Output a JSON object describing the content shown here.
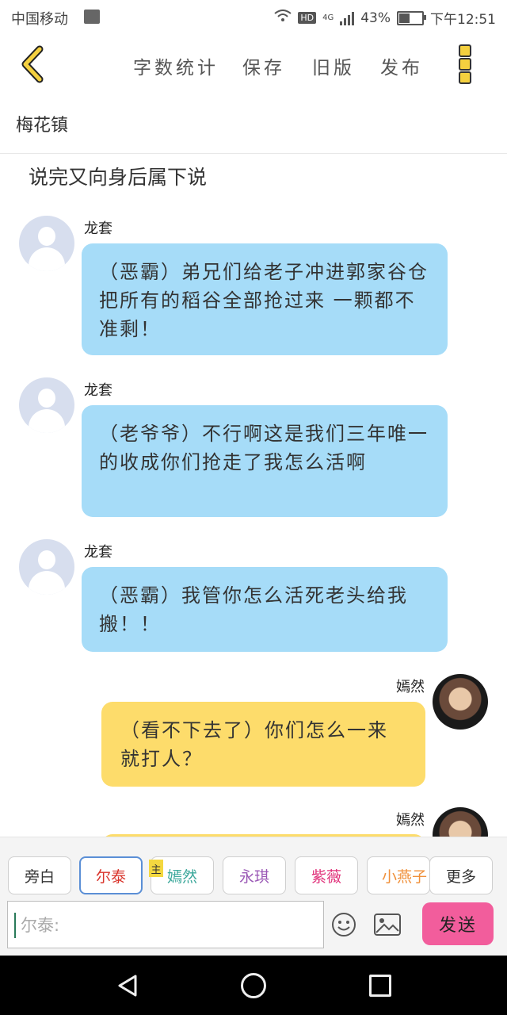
{
  "status_bar": {
    "carrier": "中国移动",
    "network": "4G",
    "hd": "HD",
    "battery": "43%",
    "battery_level": 0.43,
    "time": "下午12:51"
  },
  "toolbar": {
    "word_count": "字数统计",
    "save": "保存",
    "old_version": "旧版",
    "publish": "发布"
  },
  "chapter": {
    "location": "梅花镇",
    "narration": "说完又向身后属下说"
  },
  "messages": [
    {
      "speaker": "龙套",
      "side": "left",
      "text": "（恶霸）弟兄们给老子冲进郭家谷仓把所有的稻谷全部抢过来 一颗都不准剩！"
    },
    {
      "speaker": "龙套",
      "side": "left",
      "text": "（老爷爷）不行啊这是我们三年唯一的收成你们抢走了我怎么活啊"
    },
    {
      "speaker": "龙套",
      "side": "left",
      "text": "（恶霸）我管你怎么活死老头给我搬！！"
    },
    {
      "speaker": "嫣然",
      "side": "right",
      "text": "（看不下去了）你们怎么一来就打人？"
    },
    {
      "speaker": "嫣然",
      "side": "right",
      "text": ""
    }
  ],
  "characters": [
    "旁白",
    "尔泰",
    "嫣然",
    "永琪",
    "紫薇",
    "小燕子",
    "更多"
  ],
  "character_colors": [
    "#333333",
    "#d9342b",
    "#3aa79a",
    "#9b59b6",
    "#e0317a",
    "#f0903a",
    "#333333"
  ],
  "main_tag": "主",
  "input": {
    "placeholder": "尔泰:",
    "value": ""
  },
  "send_label": "发送",
  "colors": {
    "accent": "#f25d9c",
    "left_bubble": "#a6dcf8",
    "right_bubble": "#fddc6b",
    "back_arrow": "#f4d03f"
  }
}
